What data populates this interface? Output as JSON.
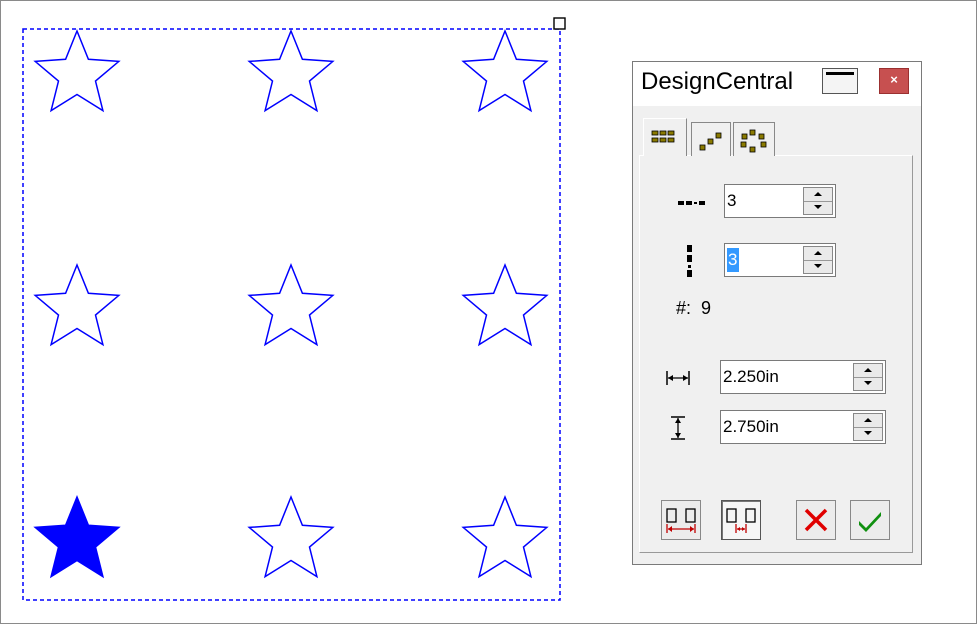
{
  "panel": {
    "title": "DesignCentral",
    "close_glyph": "×",
    "tabs": [
      {
        "icon": "grid-layout-icon",
        "selected": true
      },
      {
        "icon": "diagonal-layout-icon",
        "selected": false
      },
      {
        "icon": "circular-layout-icon",
        "selected": false
      }
    ],
    "columns": {
      "icon": "columns-icon",
      "value": "3"
    },
    "rows": {
      "icon": "rows-icon",
      "value": "3"
    },
    "count": {
      "label": "#:",
      "value": "9"
    },
    "horizontal_spacing": {
      "icon": "horizontal-spacing-icon",
      "value": "2.250in"
    },
    "vertical_spacing": {
      "icon": "vertical-spacing-icon",
      "value": "2.750in"
    },
    "buttons": [
      {
        "icon": "fit-spacing-icon"
      },
      {
        "icon": "fixed-spacing-icon",
        "pressed": true
      },
      {
        "icon": "cancel-icon"
      },
      {
        "icon": "apply-icon"
      }
    ]
  },
  "design": {
    "grid": {
      "columns": 3,
      "rows": 3
    },
    "star_outline_color": "#0000ff",
    "selected_star_fill": "#0000ff",
    "selection_border_color": "#0000ff"
  }
}
